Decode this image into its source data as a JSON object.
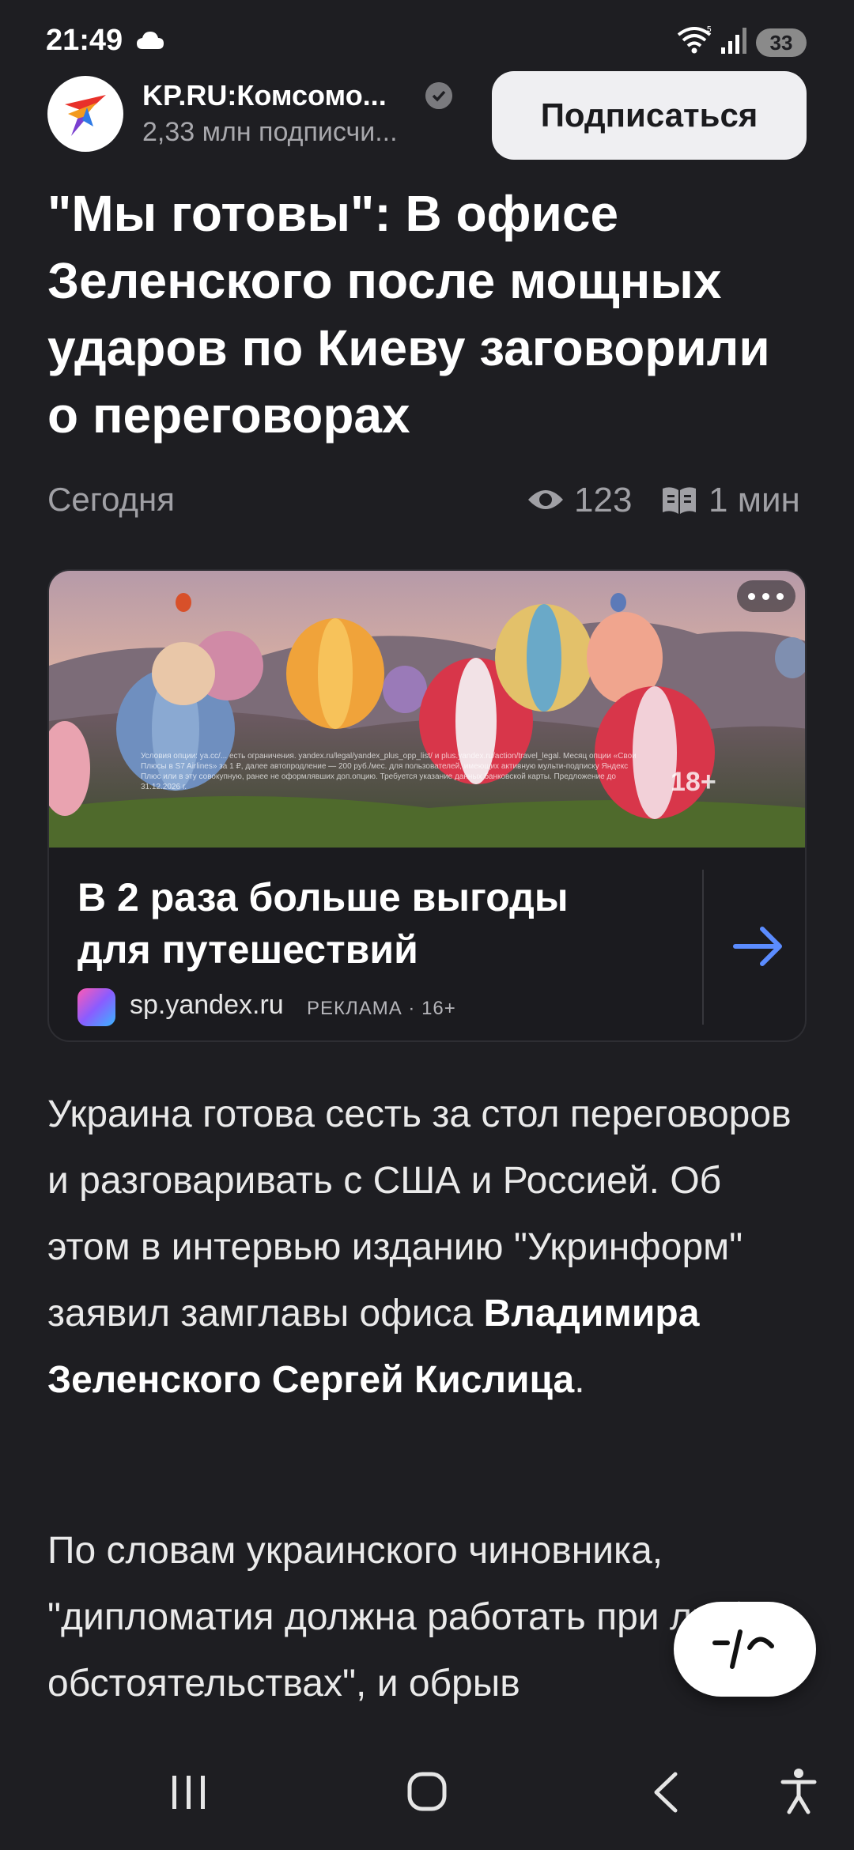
{
  "status_bar": {
    "time": "21:49",
    "battery": "33",
    "icons": [
      "cloud-icon",
      "wifi-icon",
      "signal-icon",
      "battery-icon"
    ]
  },
  "channel": {
    "name": "KP.RU:Комсомо...",
    "subscribers": "2,33 млн подписчи...",
    "subscribe_label": "Подписаться",
    "verified_icon": "verified-icon"
  },
  "article": {
    "title": "\"Мы готовы\": В офисе Зеленского после мощных ударов по Киеву заговорили о переговорах",
    "date": "Сегодня",
    "views": "123",
    "read_time": "1 мин"
  },
  "ad": {
    "headline": "В 2 раза больше выгоды для путешествий",
    "source": "sp.yandex.ru",
    "label": "РЕКЛАМА · 16+",
    "age_badge": "18+",
    "fine_print": "Условия опции: ya.cc/... есть ограничения. yandex.ru/legal/yandex_plus_opp_list/ и plus.yandex.ru/action/travel_legal. Месяц опции «Свои Плюсы в S7 Airlines» за 1 ₽, далее автопродление — 200 руб./мес. для пользователей, имеющих активную мульти-подписку Яндекс Плюс или в эту совокупную, ранее не оформлявших доп.опцию. Требуется указание данных банковской карты. Предложение до 31.12.2026 г.",
    "accent_color": "#5b8cff"
  },
  "body": {
    "p1_a": "Украина готова сесть за стол переговоров и разговаривать с США и Россией. Об этом в интервью изданию \"Укринформ\" заявил замглавы офиса ",
    "p1_bold": "Владимира Зеленского Сергей Кислица",
    "p1_end": ".",
    "p2": "По словам украинского чиновника, \"дипломатия должна работать при любых обстоятельствах\", и обрыв"
  },
  "navbar": {
    "icons": [
      "recent-apps-icon",
      "home-icon",
      "back-icon",
      "accessibility-icon"
    ]
  }
}
